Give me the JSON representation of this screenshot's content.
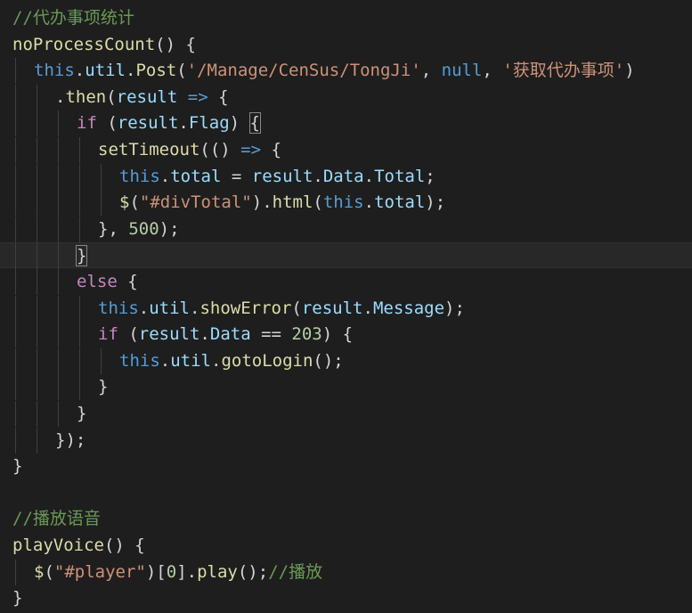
{
  "editor": {
    "lines": [
      {
        "indent": 0,
        "guides": 0,
        "tokens": [
          {
            "t": "//代办事项统计",
            "c": "cm"
          }
        ]
      },
      {
        "indent": 0,
        "guides": 0,
        "tokens": [
          {
            "t": "noProcessCount",
            "c": "fn"
          },
          {
            "t": "() {",
            "c": "pu"
          }
        ]
      },
      {
        "indent": 1,
        "guides": 1,
        "tokens": [
          {
            "t": "this",
            "c": "kw"
          },
          {
            "t": ".",
            "c": "pu"
          },
          {
            "t": "util",
            "c": "vr"
          },
          {
            "t": ".",
            "c": "pu"
          },
          {
            "t": "Post",
            "c": "fn"
          },
          {
            "t": "(",
            "c": "pu"
          },
          {
            "t": "'/Manage/CenSus/TongJi'",
            "c": "str"
          },
          {
            "t": ", ",
            "c": "pu"
          },
          {
            "t": "null",
            "c": "kw"
          },
          {
            "t": ", ",
            "c": "pu"
          },
          {
            "t": "'获取代办事项'",
            "c": "str"
          },
          {
            "t": ")",
            "c": "pu"
          }
        ]
      },
      {
        "indent": 2,
        "guides": 2,
        "tokens": [
          {
            "t": ".",
            "c": "pu"
          },
          {
            "t": "then",
            "c": "fn"
          },
          {
            "t": "(",
            "c": "pu"
          },
          {
            "t": "result",
            "c": "vr"
          },
          {
            "t": " ",
            "c": "pu"
          },
          {
            "t": "=>",
            "c": "kw"
          },
          {
            "t": " {",
            "c": "pu"
          }
        ]
      },
      {
        "indent": 3,
        "guides": 3,
        "tokens": [
          {
            "t": "if",
            "c": "ctl"
          },
          {
            "t": " (",
            "c": "pu"
          },
          {
            "t": "result",
            "c": "vr"
          },
          {
            "t": ".",
            "c": "pu"
          },
          {
            "t": "Flag",
            "c": "vr"
          },
          {
            "t": ") ",
            "c": "pu"
          },
          {
            "t": "{",
            "c": "br"
          }
        ]
      },
      {
        "indent": 4,
        "guides": 4,
        "tokens": [
          {
            "t": "setTimeout",
            "c": "fn"
          },
          {
            "t": "(() ",
            "c": "pu"
          },
          {
            "t": "=>",
            "c": "kw"
          },
          {
            "t": " {",
            "c": "pu"
          }
        ]
      },
      {
        "indent": 5,
        "guides": 5,
        "tokens": [
          {
            "t": "this",
            "c": "kw"
          },
          {
            "t": ".",
            "c": "pu"
          },
          {
            "t": "total",
            "c": "vr"
          },
          {
            "t": " = ",
            "c": "pu"
          },
          {
            "t": "result",
            "c": "vr"
          },
          {
            "t": ".",
            "c": "pu"
          },
          {
            "t": "Data",
            "c": "vr"
          },
          {
            "t": ".",
            "c": "pu"
          },
          {
            "t": "Total",
            "c": "vr"
          },
          {
            "t": ";",
            "c": "pu"
          }
        ]
      },
      {
        "indent": 5,
        "guides": 5,
        "tokens": [
          {
            "t": "$",
            "c": "fn"
          },
          {
            "t": "(",
            "c": "pu"
          },
          {
            "t": "\"#divTotal\"",
            "c": "str"
          },
          {
            "t": ").",
            "c": "pu"
          },
          {
            "t": "html",
            "c": "fn"
          },
          {
            "t": "(",
            "c": "pu"
          },
          {
            "t": "this",
            "c": "kw"
          },
          {
            "t": ".",
            "c": "pu"
          },
          {
            "t": "total",
            "c": "vr"
          },
          {
            "t": ");",
            "c": "pu"
          }
        ]
      },
      {
        "indent": 4,
        "guides": 4,
        "tokens": [
          {
            "t": "}, ",
            "c": "pu"
          },
          {
            "t": "500",
            "c": "num"
          },
          {
            "t": ");",
            "c": "pu"
          }
        ]
      },
      {
        "indent": 3,
        "guides": 3,
        "current": true,
        "tokens": [
          {
            "t": "}",
            "c": "br"
          }
        ]
      },
      {
        "indent": 3,
        "guides": 3,
        "tokens": [
          {
            "t": "else",
            "c": "ctl"
          },
          {
            "t": " {",
            "c": "pu"
          }
        ]
      },
      {
        "indent": 4,
        "guides": 4,
        "tokens": [
          {
            "t": "this",
            "c": "kw"
          },
          {
            "t": ".",
            "c": "pu"
          },
          {
            "t": "util",
            "c": "vr"
          },
          {
            "t": ".",
            "c": "pu"
          },
          {
            "t": "showError",
            "c": "fn"
          },
          {
            "t": "(",
            "c": "pu"
          },
          {
            "t": "result",
            "c": "vr"
          },
          {
            "t": ".",
            "c": "pu"
          },
          {
            "t": "Message",
            "c": "vr"
          },
          {
            "t": ");",
            "c": "pu"
          }
        ]
      },
      {
        "indent": 4,
        "guides": 4,
        "tokens": [
          {
            "t": "if",
            "c": "ctl"
          },
          {
            "t": " (",
            "c": "pu"
          },
          {
            "t": "result",
            "c": "vr"
          },
          {
            "t": ".",
            "c": "pu"
          },
          {
            "t": "Data",
            "c": "vr"
          },
          {
            "t": " == ",
            "c": "pu"
          },
          {
            "t": "203",
            "c": "num"
          },
          {
            "t": ") {",
            "c": "pu"
          }
        ]
      },
      {
        "indent": 5,
        "guides": 5,
        "tokens": [
          {
            "t": "this",
            "c": "kw"
          },
          {
            "t": ".",
            "c": "pu"
          },
          {
            "t": "util",
            "c": "vr"
          },
          {
            "t": ".",
            "c": "pu"
          },
          {
            "t": "gotoLogin",
            "c": "fn"
          },
          {
            "t": "();",
            "c": "pu"
          }
        ]
      },
      {
        "indent": 4,
        "guides": 4,
        "tokens": [
          {
            "t": "}",
            "c": "pu"
          }
        ]
      },
      {
        "indent": 3,
        "guides": 3,
        "tokens": [
          {
            "t": "}",
            "c": "pu"
          }
        ]
      },
      {
        "indent": 2,
        "guides": 2,
        "tokens": [
          {
            "t": "});",
            "c": "pu"
          }
        ]
      },
      {
        "indent": 0,
        "guides": 0,
        "tokens": [
          {
            "t": "}",
            "c": "pu"
          }
        ]
      },
      {
        "indent": 0,
        "guides": 0,
        "tokens": []
      },
      {
        "indent": 0,
        "guides": 0,
        "tokens": [
          {
            "t": "//播放语音",
            "c": "cm"
          }
        ]
      },
      {
        "indent": 0,
        "guides": 0,
        "tokens": [
          {
            "t": "playVoice",
            "c": "fn"
          },
          {
            "t": "() {",
            "c": "pu"
          }
        ]
      },
      {
        "indent": 1,
        "guides": 1,
        "tokens": [
          {
            "t": "$",
            "c": "fn"
          },
          {
            "t": "(",
            "c": "pu"
          },
          {
            "t": "\"#player\"",
            "c": "str"
          },
          {
            "t": ")[",
            "c": "pu"
          },
          {
            "t": "0",
            "c": "num"
          },
          {
            "t": "].",
            "c": "pu"
          },
          {
            "t": "play",
            "c": "fn"
          },
          {
            "t": "();",
            "c": "pu"
          },
          {
            "t": "//播放",
            "c": "cm"
          }
        ]
      },
      {
        "indent": 0,
        "guides": 0,
        "tokens": [
          {
            "t": "}",
            "c": "pu"
          }
        ]
      }
    ]
  }
}
